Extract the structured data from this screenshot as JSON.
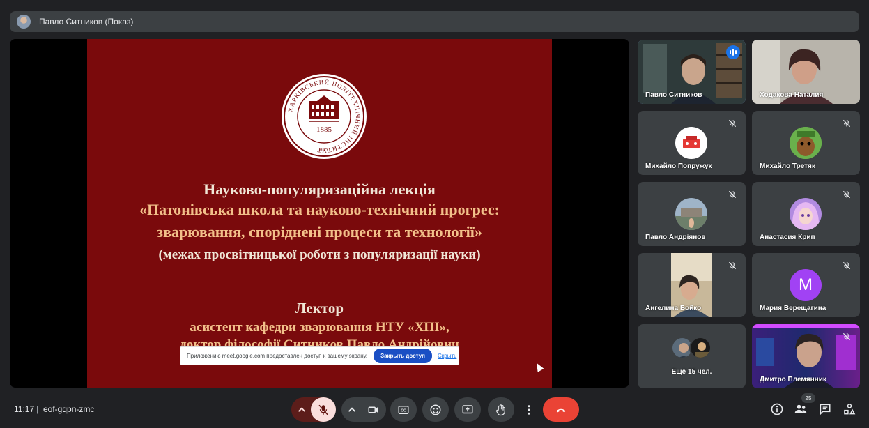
{
  "presenter_bar": {
    "title": "Павло Ситников (Показ)"
  },
  "slide": {
    "seal_text_ring": "ХАРКІВСЬКИЙ ПОЛІТЕХНІЧНИЙ ІНСТИТУТ",
    "seal_year": "1885",
    "seal_abbr": "НТУ",
    "line1": "Науково-популяризаційна лекція",
    "line2": "«Патонівська школа та науково-технічний прогрес:",
    "line3": "зварювання, споріднені процеси та технології»",
    "line4": "(межах просвітницької роботи з популяризації науки)",
    "line5": "Лектор",
    "line6": "асистент кафедри зварювання НТУ «ХПІ»,",
    "line7": "доктор філософії Ситников Павло Андрійович"
  },
  "share_notice": {
    "text": "Приложению meet.google.com предоставлен доступ к вашему экрану.",
    "stop_label": "Закрыть доступ",
    "hide_label": "Скрыть"
  },
  "participants": [
    {
      "name": "Павло Ситников"
    },
    {
      "name": "Ходакова Наталия"
    },
    {
      "name": "Михайло Попружук"
    },
    {
      "name": "Михайло Третяк"
    },
    {
      "name": "Павло Андріянов"
    },
    {
      "name": "Анастасия Крип"
    },
    {
      "name": "Ангелина Бойко"
    },
    {
      "name": "Мария Верещагина",
      "initial": "M",
      "color": "#a142f4"
    },
    {
      "name": "Ещё 15 чел."
    },
    {
      "name": "Дмитро Племянник"
    }
  ],
  "bottom_bar": {
    "time": "11:17",
    "separator": "|",
    "meeting_code": "eof-gqpn-zmc",
    "participant_count": "25"
  },
  "colors": {
    "end_call": "#ea4335",
    "mic_off": "#f9dedc",
    "mic_off_group": "#5c1d1a",
    "accent": "#8ab4f8"
  }
}
